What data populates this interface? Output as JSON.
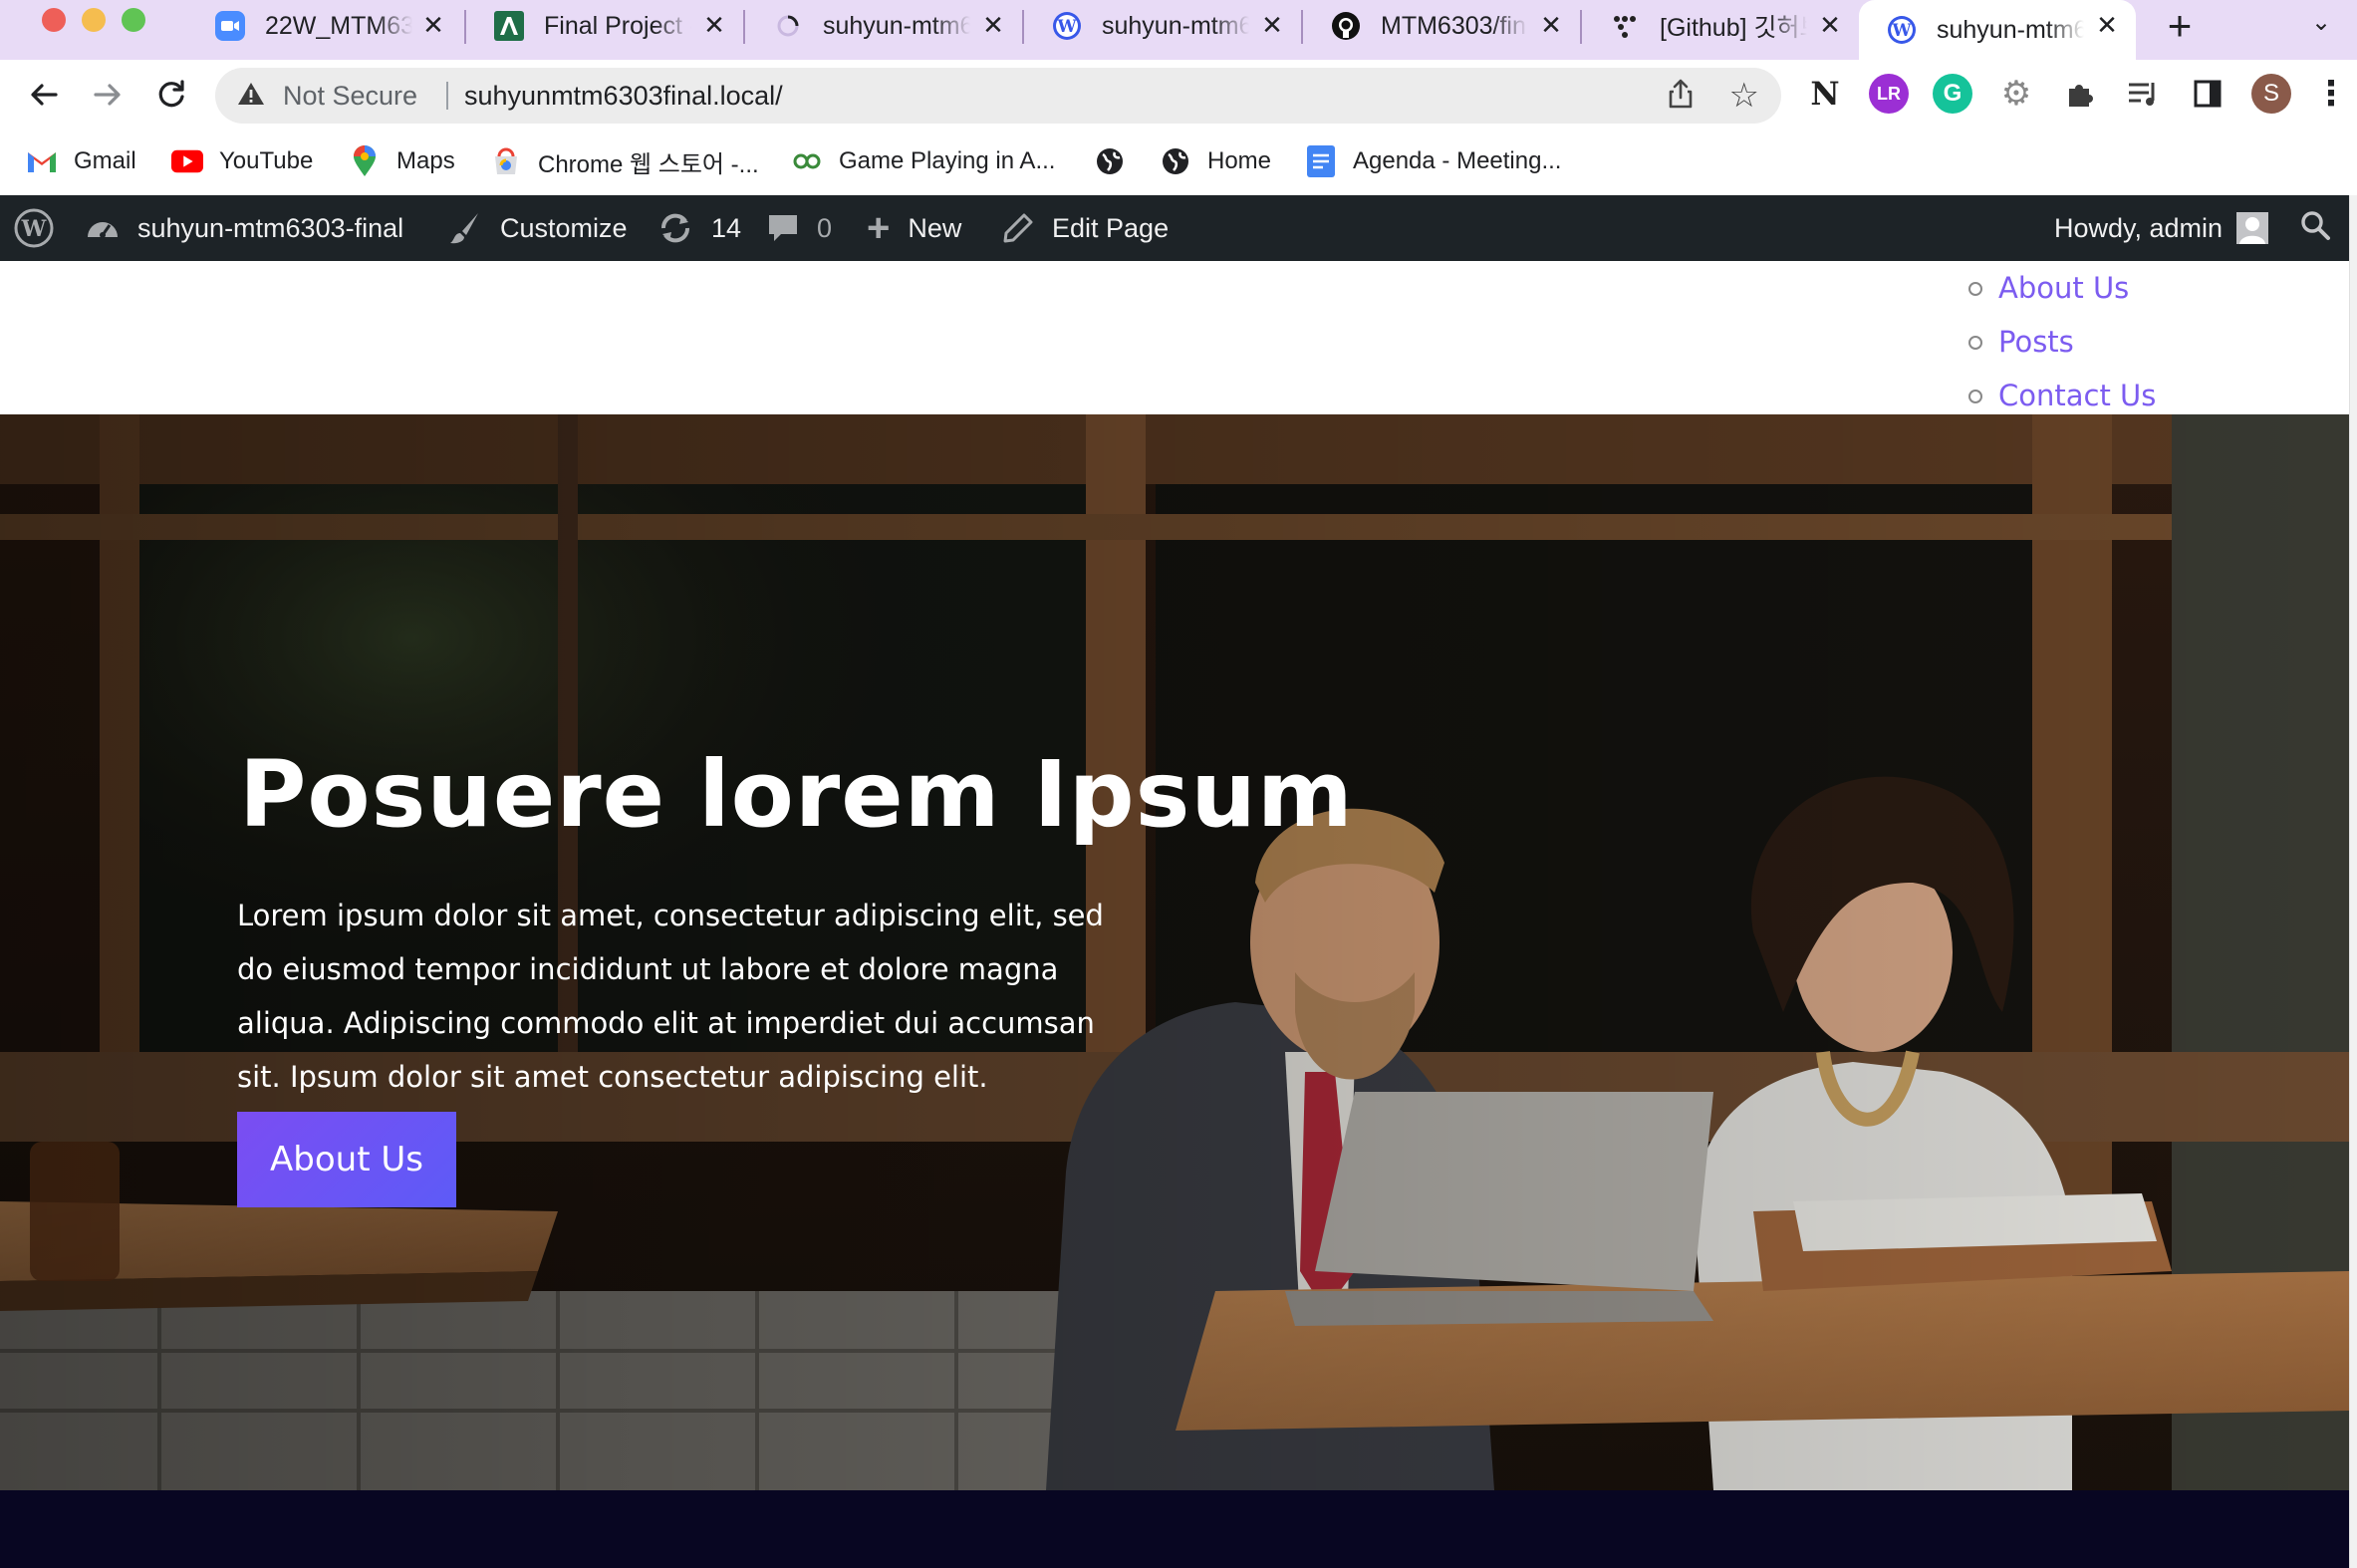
{
  "browser": {
    "tabs": [
      {
        "title": "22W_MTM63",
        "icon": "zoom-icon",
        "active": false
      },
      {
        "title": "Final Project -",
        "icon": "acrobat-icon",
        "active": false
      },
      {
        "title": "suhyun-mtm6",
        "icon": "loading-icon",
        "active": false
      },
      {
        "title": "suhyun-mtm6",
        "icon": "wordpress-icon",
        "active": false
      },
      {
        "title": "MTM6303/fin",
        "icon": "github-icon",
        "active": false
      },
      {
        "title": "[Github] 깃허브",
        "icon": "dots-icon",
        "active": false
      },
      {
        "title": "suhyun-mtm6",
        "icon": "wordpress-icon",
        "active": true
      }
    ],
    "security_label": "Not Secure",
    "url": "suhyunmtm6303final.local/",
    "profile_initial": "S",
    "bookmarks": [
      {
        "label": "Gmail",
        "icon": "gmail-icon"
      },
      {
        "label": "YouTube",
        "icon": "youtube-icon"
      },
      {
        "label": "Maps",
        "icon": "maps-icon"
      },
      {
        "label": "Chrome 웹 스토어 -...",
        "icon": "chrome-webstore-icon"
      },
      {
        "label": "Game Playing in A...",
        "icon": "link-icon"
      },
      {
        "label": "",
        "icon": "globe-icon"
      },
      {
        "label": "Home",
        "icon": "globe-icon"
      },
      {
        "label": "Agenda - Meeting...",
        "icon": "docs-icon"
      }
    ]
  },
  "adminbar": {
    "site_name": "suhyun-mtm6303-final",
    "customize": "Customize",
    "updates": "14",
    "comments": "0",
    "new": "New",
    "edit_page": "Edit Page",
    "howdy": "Howdy, admin"
  },
  "site": {
    "nav": [
      "About Us",
      "Posts",
      "Contact Us"
    ],
    "hero": {
      "title": "Posuere lorem Ipsum",
      "text": "Lorem ipsum dolor sit amet, consectetur adipiscing elit, sed do eiusmod tempor incididunt ut labore et dolore magna aliqua. Adipiscing commodo elit at imperdiet dui accumsan sit. Ipsum dolor sit amet consectetur adipiscing elit.",
      "button": "About Us"
    }
  },
  "colors": {
    "tabstrip": "#e8dbf6",
    "adminbar": "#1d2327",
    "nav_link": "#7c5cf0",
    "button": "#6a54f5",
    "footer": "#080622"
  }
}
